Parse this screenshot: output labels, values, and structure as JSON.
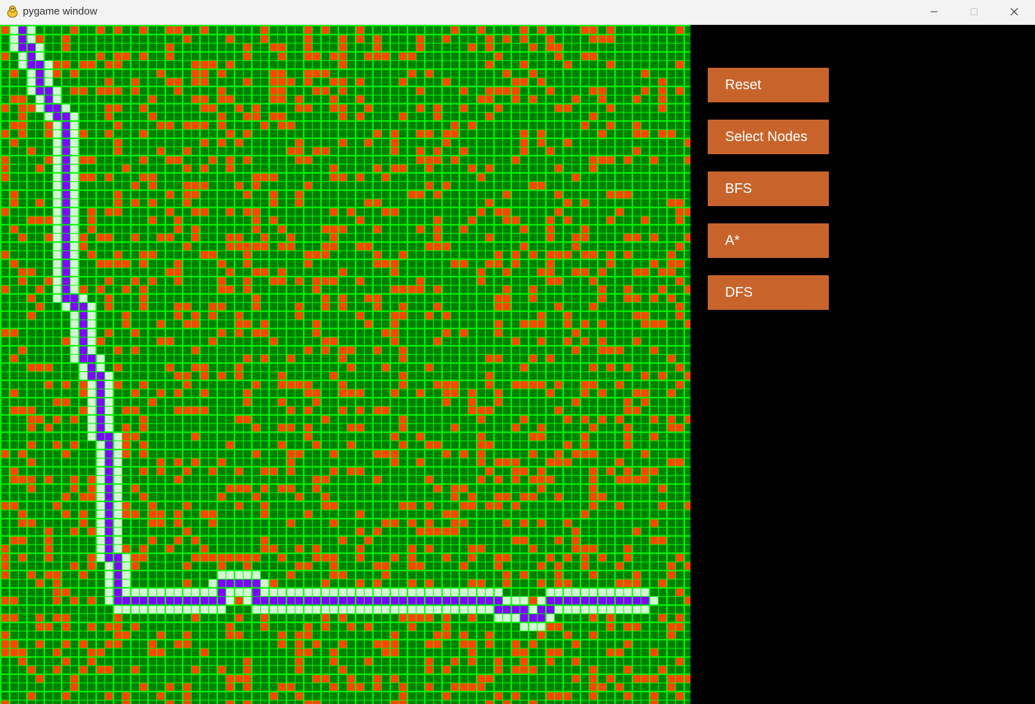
{
  "window": {
    "title": "pygame window",
    "app_icon": "pygame-snake-icon"
  },
  "controls": {
    "minimize_icon": "minimize-icon",
    "maximize_icon": "maximize-icon",
    "close_icon": "close-icon"
  },
  "buttons": [
    {
      "label": "Reset"
    },
    {
      "label": "Select Nodes"
    },
    {
      "label": "BFS"
    },
    {
      "label": "A*"
    },
    {
      "label": "DFS"
    }
  ],
  "colors": {
    "empty": "#008000",
    "grid_line": "#00ff00",
    "wall": "#ff4500",
    "visited": "#d5f5d5",
    "path": "#8000ff",
    "button": "#c8642b",
    "button_text": "#ffffff"
  },
  "grid": {
    "cols": 80,
    "rows": 79
  },
  "path_cells": [
    [
      2,
      0
    ],
    [
      2,
      1
    ],
    [
      2,
      2
    ],
    [
      3,
      2
    ],
    [
      3,
      3
    ],
    [
      3,
      4
    ],
    [
      4,
      4
    ],
    [
      4,
      5
    ],
    [
      4,
      6
    ],
    [
      4,
      7
    ],
    [
      5,
      7
    ],
    [
      5,
      8
    ],
    [
      5,
      9
    ],
    [
      6,
      9
    ],
    [
      6,
      10
    ],
    [
      7,
      10
    ],
    [
      7,
      11
    ],
    [
      7,
      12
    ],
    [
      7,
      13
    ],
    [
      7,
      14
    ],
    [
      7,
      15
    ],
    [
      7,
      16
    ],
    [
      7,
      17
    ],
    [
      7,
      18
    ],
    [
      7,
      19
    ],
    [
      7,
      20
    ],
    [
      7,
      21
    ],
    [
      7,
      22
    ],
    [
      7,
      23
    ],
    [
      7,
      24
    ],
    [
      7,
      25
    ],
    [
      7,
      26
    ],
    [
      7,
      27
    ],
    [
      7,
      28
    ],
    [
      7,
      29
    ],
    [
      7,
      30
    ],
    [
      7,
      31
    ],
    [
      8,
      31
    ],
    [
      8,
      32
    ],
    [
      9,
      32
    ],
    [
      9,
      33
    ],
    [
      9,
      34
    ],
    [
      9,
      35
    ],
    [
      9,
      36
    ],
    [
      9,
      37
    ],
    [
      9,
      38
    ],
    [
      10,
      38
    ],
    [
      10,
      39
    ],
    [
      10,
      40
    ],
    [
      11,
      40
    ],
    [
      11,
      41
    ],
    [
      11,
      42
    ],
    [
      11,
      43
    ],
    [
      11,
      44
    ],
    [
      11,
      45
    ],
    [
      11,
      46
    ],
    [
      11,
      47
    ],
    [
      12,
      47
    ],
    [
      12,
      48
    ],
    [
      12,
      49
    ],
    [
      12,
      50
    ],
    [
      12,
      51
    ],
    [
      12,
      52
    ],
    [
      12,
      53
    ],
    [
      12,
      54
    ],
    [
      12,
      55
    ],
    [
      12,
      56
    ],
    [
      12,
      57
    ],
    [
      12,
      58
    ],
    [
      12,
      59
    ],
    [
      12,
      60
    ],
    [
      12,
      61
    ],
    [
      13,
      61
    ],
    [
      13,
      62
    ],
    [
      13,
      63
    ],
    [
      13,
      64
    ],
    [
      13,
      65
    ],
    [
      13,
      66
    ],
    [
      14,
      66
    ],
    [
      15,
      66
    ],
    [
      16,
      66
    ],
    [
      17,
      66
    ],
    [
      18,
      66
    ],
    [
      19,
      66
    ],
    [
      20,
      66
    ],
    [
      21,
      66
    ],
    [
      22,
      66
    ],
    [
      23,
      66
    ],
    [
      24,
      66
    ],
    [
      25,
      66
    ],
    [
      25,
      65
    ],
    [
      25,
      64
    ],
    [
      26,
      64
    ],
    [
      27,
      64
    ],
    [
      28,
      64
    ],
    [
      29,
      64
    ],
    [
      29,
      65
    ],
    [
      29,
      66
    ],
    [
      30,
      66
    ],
    [
      31,
      66
    ],
    [
      32,
      66
    ],
    [
      33,
      66
    ],
    [
      34,
      66
    ],
    [
      35,
      66
    ],
    [
      36,
      66
    ],
    [
      37,
      66
    ],
    [
      38,
      66
    ],
    [
      39,
      66
    ],
    [
      40,
      66
    ],
    [
      41,
      66
    ],
    [
      42,
      66
    ],
    [
      43,
      66
    ],
    [
      44,
      66
    ],
    [
      45,
      66
    ],
    [
      46,
      66
    ],
    [
      47,
      66
    ],
    [
      48,
      66
    ],
    [
      49,
      66
    ],
    [
      50,
      66
    ],
    [
      51,
      66
    ],
    [
      52,
      66
    ],
    [
      53,
      66
    ],
    [
      54,
      66
    ],
    [
      55,
      66
    ],
    [
      56,
      66
    ],
    [
      57,
      66
    ],
    [
      57,
      67
    ],
    [
      58,
      67
    ],
    [
      59,
      67
    ],
    [
      60,
      67
    ],
    [
      60,
      68
    ],
    [
      61,
      68
    ],
    [
      62,
      68
    ],
    [
      62,
      67
    ],
    [
      63,
      67
    ],
    [
      63,
      66
    ],
    [
      64,
      66
    ],
    [
      65,
      66
    ],
    [
      66,
      66
    ],
    [
      67,
      66
    ],
    [
      68,
      66
    ],
    [
      69,
      66
    ],
    [
      70,
      66
    ],
    [
      71,
      66
    ],
    [
      72,
      66
    ],
    [
      73,
      66
    ],
    [
      74,
      66
    ]
  ]
}
